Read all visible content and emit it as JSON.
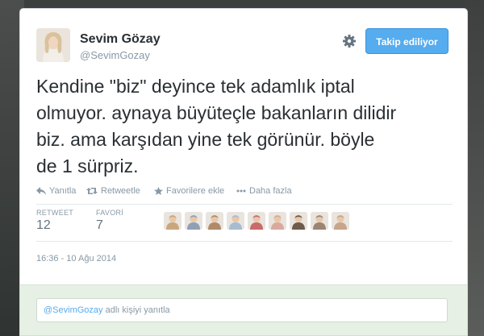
{
  "profile": {
    "name": "Sevim Gözay",
    "handle": "@SevimGozay"
  },
  "follow_button_label": "Takip ediliyor",
  "tweet": {
    "lines": [
      "Kendine \"biz\" deyince tek adamlık iptal",
      "olmuyor. aynaya büyüteçle bakanların dilidir",
      "biz. ama karşıdan yine tek görünür. böyle",
      "de 1 sürpriz."
    ]
  },
  "actions": {
    "reply": "Yanıtla",
    "retweet": "Retweetle",
    "favorite": "Favorilere ekle",
    "more": "Daha fazla"
  },
  "stats": {
    "retweet_label": "RETWEET",
    "retweet_count": "12",
    "favorite_label": "FAVORİ",
    "favorite_count": "7"
  },
  "favoriters": [
    {
      "icon": "user-avatar-1",
      "color": "#c9a77d"
    },
    {
      "icon": "user-avatar-2",
      "color": "#8fa0b5"
    },
    {
      "icon": "user-avatar-3",
      "color": "#b08a6a"
    },
    {
      "icon": "user-avatar-4",
      "color": "#a7bcd0"
    },
    {
      "icon": "user-avatar-5",
      "color": "#c96b6b"
    },
    {
      "icon": "user-avatar-6",
      "color": "#d9a9a0"
    },
    {
      "icon": "user-avatar-7",
      "color": "#6e5b4d"
    },
    {
      "icon": "user-avatar-8",
      "color": "#9b8574"
    },
    {
      "icon": "user-avatar-9",
      "color": "#c6a58c"
    }
  ],
  "timestamp": "16:36 - 10 Ağu 2014",
  "reply": {
    "mention": "@SevimGozay",
    "suffix": " adlı kişiyi yanıtla"
  },
  "colors": {
    "accent": "#55acee",
    "text": "#292f33",
    "muted": "#8899a6",
    "reply_bg": "#e6f0e4"
  }
}
